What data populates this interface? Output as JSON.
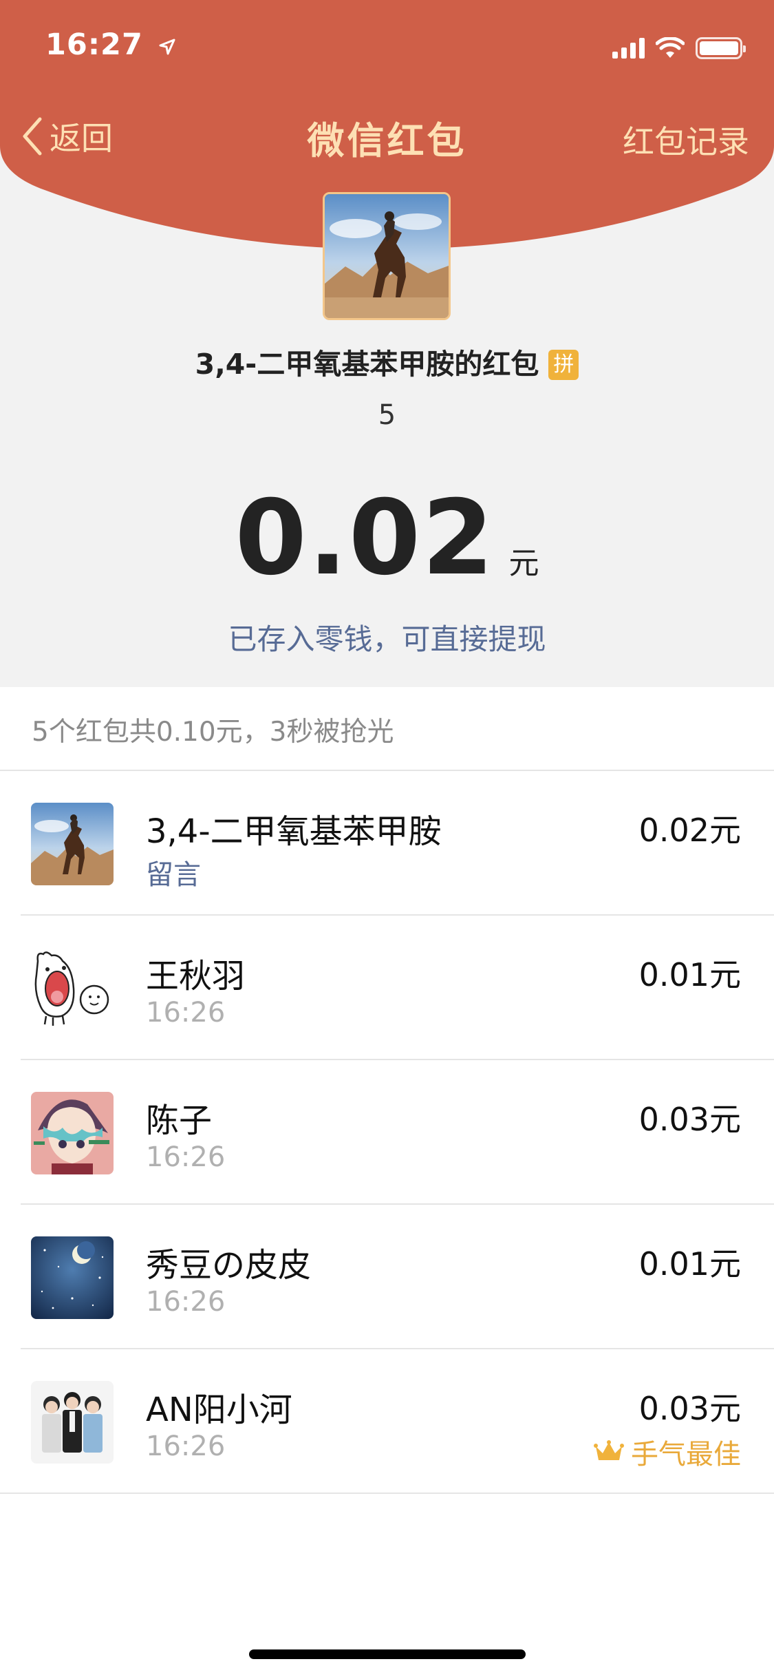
{
  "status_bar": {
    "time": "16:27"
  },
  "nav": {
    "back_label": "返回",
    "title": "微信红包",
    "records_label": "红包记录"
  },
  "packet": {
    "sender": "3,4-二甲氧基苯甲胺的红包",
    "pin_badge": "拼",
    "greeting": "5",
    "amount": "0.02",
    "unit": "元",
    "deposit_note": "已存入零钱，可直接提现"
  },
  "summary": "5个红包共0.10元，3秒被抢光",
  "recipients": [
    {
      "name": "3,4-二甲氧基苯甲胺",
      "sub": "留言",
      "amount": "0.02元",
      "avatar": "horse-rider-avatar"
    },
    {
      "name": "王秋羽",
      "sub": "16:26",
      "amount": "0.01元",
      "avatar": "cartoon-rabbit-avatar"
    },
    {
      "name": "陈子",
      "sub": "16:26",
      "amount": "0.03元",
      "avatar": "anime-girl-avatar"
    },
    {
      "name": "秀豆の皮皮",
      "sub": "16:26",
      "amount": "0.01元",
      "avatar": "night-moon-avatar"
    },
    {
      "name": "AN阳小河",
      "sub": "16:26",
      "amount": "0.03元",
      "avatar": "group-photo-avatar",
      "best_label": "手气最佳"
    }
  ],
  "colors": {
    "header_red": "#cf5f48",
    "nav_text": "#fde0b4",
    "link_blue": "#576b95",
    "best_gold": "#e9a93a"
  }
}
